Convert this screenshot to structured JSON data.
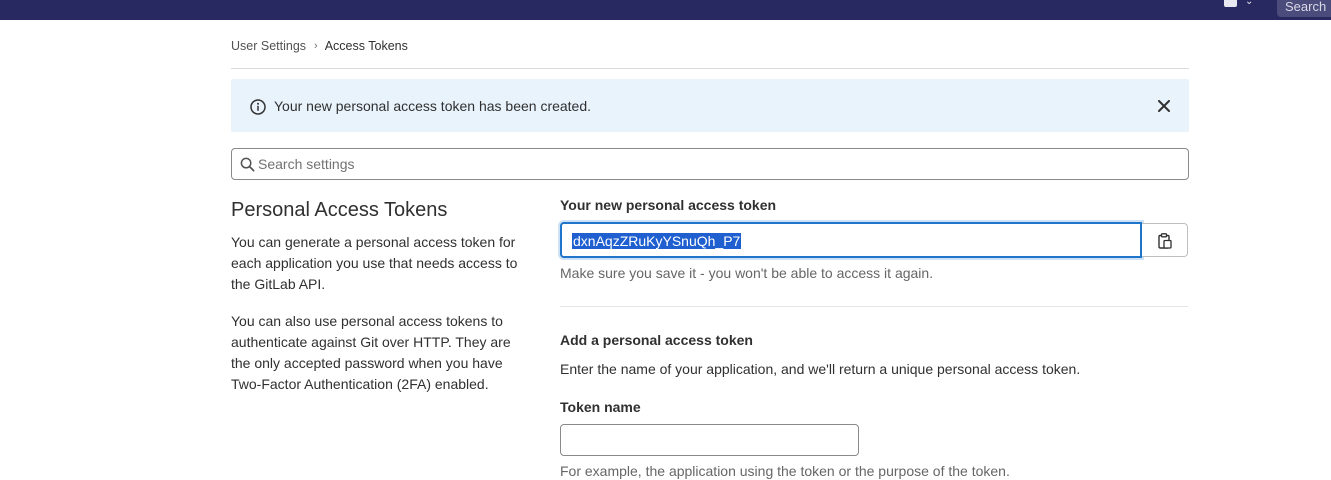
{
  "topbar": {
    "search_label": "Search",
    "color": "#292961"
  },
  "breadcrumb": {
    "parent": "User Settings",
    "current": "Access Tokens"
  },
  "alert": {
    "message": "Your new personal access token has been created.",
    "background": "#e9f3fc"
  },
  "search": {
    "placeholder": "Search settings"
  },
  "section": {
    "title": "Personal Access Tokens",
    "description_1": "You can generate a personal access token for each application you use that needs access to the GitLab API.",
    "description_2": "You can also use personal access tokens to authenticate against Git over HTTP. They are the only accepted password when you have Two-Factor Authentication (2FA) enabled."
  },
  "new_token": {
    "label": "Your new personal access token",
    "value": "dxnAqzZRuKyYSnuQh_P7",
    "help": "Make sure you save it - you won't be able to access it again."
  },
  "add_token": {
    "title": "Add a personal access token",
    "description": "Enter the name of your application, and we'll return a unique personal access token.",
    "name_label": "Token name",
    "name_value": "",
    "name_help": "For example, the application using the token or the purpose of the token."
  },
  "colors": {
    "accent": "#1f75cb",
    "selection": "#1f5fd0"
  }
}
